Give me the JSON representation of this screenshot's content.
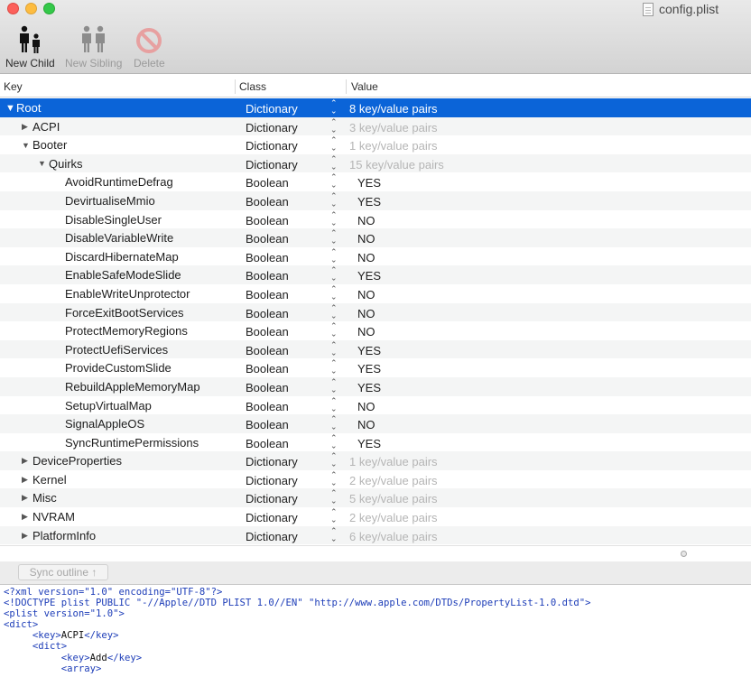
{
  "window": {
    "title": "config.plist"
  },
  "toolbar": {
    "new_child": "New Child",
    "new_sibling": "New Sibling",
    "delete": "Delete"
  },
  "columns": {
    "key": "Key",
    "class": "Class",
    "value": "Value"
  },
  "rows": [
    {
      "key": "Root",
      "class": "Dictionary",
      "value": "8 key/value pairs",
      "depth": 0,
      "disclosure": "expanded",
      "kind": "summary",
      "selected": true
    },
    {
      "key": "ACPI",
      "class": "Dictionary",
      "value": "3 key/value pairs",
      "depth": 1,
      "disclosure": "collapsed",
      "kind": "summary"
    },
    {
      "key": "Booter",
      "class": "Dictionary",
      "value": "1 key/value pairs",
      "depth": 1,
      "disclosure": "expanded",
      "kind": "summary"
    },
    {
      "key": "Quirks",
      "class": "Dictionary",
      "value": "15 key/value pairs",
      "depth": 2,
      "disclosure": "expanded",
      "kind": "summary"
    },
    {
      "key": "AvoidRuntimeDefrag",
      "class": "Boolean",
      "value": "YES",
      "depth": 3,
      "disclosure": "none",
      "kind": "bool"
    },
    {
      "key": "DevirtualiseMmio",
      "class": "Boolean",
      "value": "YES",
      "depth": 3,
      "disclosure": "none",
      "kind": "bool"
    },
    {
      "key": "DisableSingleUser",
      "class": "Boolean",
      "value": "NO",
      "depth": 3,
      "disclosure": "none",
      "kind": "bool"
    },
    {
      "key": "DisableVariableWrite",
      "class": "Boolean",
      "value": "NO",
      "depth": 3,
      "disclosure": "none",
      "kind": "bool"
    },
    {
      "key": "DiscardHibernateMap",
      "class": "Boolean",
      "value": "NO",
      "depth": 3,
      "disclosure": "none",
      "kind": "bool"
    },
    {
      "key": "EnableSafeModeSlide",
      "class": "Boolean",
      "value": "YES",
      "depth": 3,
      "disclosure": "none",
      "kind": "bool"
    },
    {
      "key": "EnableWriteUnprotector",
      "class": "Boolean",
      "value": "NO",
      "depth": 3,
      "disclosure": "none",
      "kind": "bool"
    },
    {
      "key": "ForceExitBootServices",
      "class": "Boolean",
      "value": "NO",
      "depth": 3,
      "disclosure": "none",
      "kind": "bool"
    },
    {
      "key": "ProtectMemoryRegions",
      "class": "Boolean",
      "value": "NO",
      "depth": 3,
      "disclosure": "none",
      "kind": "bool"
    },
    {
      "key": "ProtectUefiServices",
      "class": "Boolean",
      "value": "YES",
      "depth": 3,
      "disclosure": "none",
      "kind": "bool"
    },
    {
      "key": "ProvideCustomSlide",
      "class": "Boolean",
      "value": "YES",
      "depth": 3,
      "disclosure": "none",
      "kind": "bool"
    },
    {
      "key": "RebuildAppleMemoryMap",
      "class": "Boolean",
      "value": "YES",
      "depth": 3,
      "disclosure": "none",
      "kind": "bool"
    },
    {
      "key": "SetupVirtualMap",
      "class": "Boolean",
      "value": "NO",
      "depth": 3,
      "disclosure": "none",
      "kind": "bool"
    },
    {
      "key": "SignalAppleOS",
      "class": "Boolean",
      "value": "NO",
      "depth": 3,
      "disclosure": "none",
      "kind": "bool"
    },
    {
      "key": "SyncRuntimePermissions",
      "class": "Boolean",
      "value": "YES",
      "depth": 3,
      "disclosure": "none",
      "kind": "bool"
    },
    {
      "key": "DeviceProperties",
      "class": "Dictionary",
      "value": "1 key/value pairs",
      "depth": 1,
      "disclosure": "collapsed",
      "kind": "summary"
    },
    {
      "key": "Kernel",
      "class": "Dictionary",
      "value": "2 key/value pairs",
      "depth": 1,
      "disclosure": "collapsed",
      "kind": "summary"
    },
    {
      "key": "Misc",
      "class": "Dictionary",
      "value": "5 key/value pairs",
      "depth": 1,
      "disclosure": "collapsed",
      "kind": "summary"
    },
    {
      "key": "NVRAM",
      "class": "Dictionary",
      "value": "2 key/value pairs",
      "depth": 1,
      "disclosure": "collapsed",
      "kind": "summary"
    },
    {
      "key": "PlatformInfo",
      "class": "Dictionary",
      "value": "6 key/value pairs",
      "depth": 1,
      "disclosure": "collapsed",
      "kind": "summary"
    }
  ],
  "sync": {
    "label": "Sync outline ↑"
  },
  "source": {
    "lines": [
      "<?xml version=\"1.0\" encoding=\"UTF-8\"?>",
      "<!DOCTYPE plist PUBLIC \"-//Apple//DTD PLIST 1.0//EN\" \"http://www.apple.com/DTDs/PropertyList-1.0.dtd\">",
      "<plist version=\"1.0\">",
      "<dict>",
      "     <key>ACPI</key>",
      "     <dict>",
      "          <key>Add</key>",
      "          <array>"
    ]
  },
  "colors": {
    "selection": "#0b64d8",
    "xml_tag": "#1d3db8",
    "summary_text": "#b5b5b5"
  },
  "icons": {
    "new_child": "parent-child-people-icon",
    "new_sibling": "sibling-people-icon",
    "delete": "no-entry-icon",
    "disclosure_expanded": "triangle-down",
    "disclosure_collapsed": "triangle-right",
    "value_stepper": "up-down-chevron"
  }
}
